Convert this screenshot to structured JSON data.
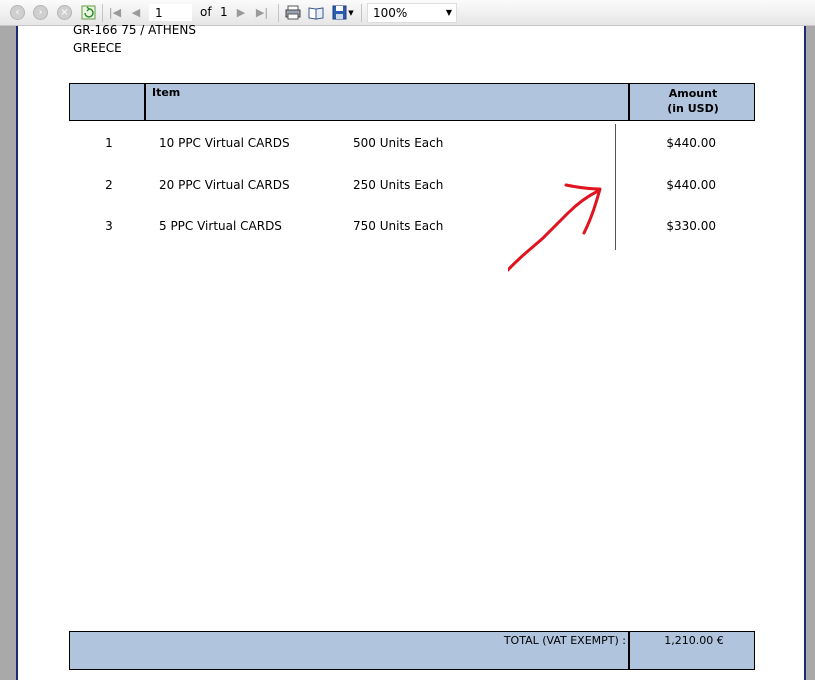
{
  "toolbar": {
    "page_current": "1",
    "of_label": "of",
    "page_total": "1",
    "zoom": "100%"
  },
  "address": {
    "line1": "GR-166 75 / ATHENS",
    "line2": "GREECE"
  },
  "table": {
    "header_item": "Item",
    "header_amount_1": "Amount",
    "header_amount_2": "(in USD)",
    "rows": [
      {
        "num": "1",
        "item": "10 PPC Virtual CARDS",
        "units": "500 Units Each",
        "amount": "$440.00"
      },
      {
        "num": "2",
        "item": "20 PPC Virtual CARDS",
        "units": "250 Units Each",
        "amount": "$440.00"
      },
      {
        "num": "3",
        "item": "5 PPC Virtual CARDS",
        "units": "750 Units Each",
        "amount": "$330.00"
      }
    ]
  },
  "total": {
    "label": "TOTAL (VAT EXEMPT) :",
    "value": "1,210.00 €"
  },
  "colors": {
    "header_fill": "#b0c4de",
    "annotation_arrow": "#e0141e",
    "page_border": "#1f2b7a"
  }
}
